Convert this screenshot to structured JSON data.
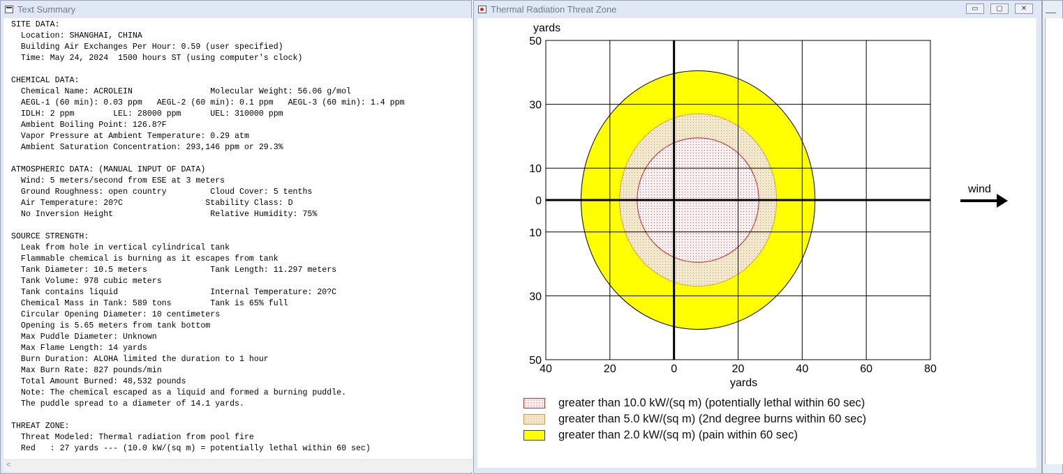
{
  "text_window": {
    "title": "Text Summary",
    "lines": [
      "SITE DATA:",
      "  Location: SHANGHAI, CHINA",
      "  Building Air Exchanges Per Hour: 0.59 (user specified)",
      "  Time: May 24, 2024  1500 hours ST (using computer's clock)",
      "",
      "CHEMICAL DATA:",
      "  Chemical Name: ACROLEIN                Molecular Weight: 56.06 g/mol",
      "  AEGL-1 (60 min): 0.03 ppm   AEGL-2 (60 min): 0.1 ppm   AEGL-3 (60 min): 1.4 ppm",
      "  IDLH: 2 ppm        LEL: 28000 ppm      UEL: 310000 ppm",
      "  Ambient Boiling Point: 126.8?F",
      "  Vapor Pressure at Ambient Temperature: 0.29 atm",
      "  Ambient Saturation Concentration: 293,146 ppm or 29.3%",
      "",
      "ATMOSPHERIC DATA: (MANUAL INPUT OF DATA)",
      "  Wind: 5 meters/second from ESE at 3 meters",
      "  Ground Roughness: open country         Cloud Cover: 5 tenths",
      "  Air Temperature: 20?C                 Stability Class: D",
      "  No Inversion Height                    Relative Humidity: 75%",
      "",
      "SOURCE STRENGTH:",
      "  Leak from hole in vertical cylindrical tank",
      "  Flammable chemical is burning as it escapes from tank",
      "  Tank Diameter: 10.5 meters             Tank Length: 11.297 meters",
      "  Tank Volume: 978 cubic meters",
      "  Tank contains liquid                   Internal Temperature: 20?C",
      "  Chemical Mass in Tank: 589 tons        Tank is 65% full",
      "  Circular Opening Diameter: 10 centimeters",
      "  Opening is 5.65 meters from tank bottom",
      "  Max Puddle Diameter: Unknown",
      "  Max Flame Length: 14 yards",
      "  Burn Duration: ALOHA limited the duration to 1 hour",
      "  Max Burn Rate: 827 pounds/min",
      "  Total Amount Burned: 48,532 pounds",
      "  Note: The chemical escaped as a liquid and formed a burning puddle.",
      "  The puddle spread to a diameter of 14.1 yards.",
      "",
      "THREAT ZONE:",
      "  Threat Modeled: Thermal radiation from pool fire",
      "  Red   : 27 yards --- (10.0 kW/(sq m) = potentially lethal within 60 sec)"
    ],
    "scroll_left_glyph": "<"
  },
  "plot_window": {
    "title": "Thermal Radiation Threat Zone",
    "buttons": {
      "minimize": "▭",
      "maximize": "▢",
      "close": "✕"
    },
    "wind_label": "wind"
  },
  "chart_data": {
    "type": "threat-zone",
    "xlabel": "yards",
    "ylabel": "yards",
    "xlim": [
      -40,
      80
    ],
    "ylim": [
      -50,
      50
    ],
    "x_ticks": [
      -40,
      -20,
      0,
      20,
      40,
      60,
      80
    ],
    "x_tick_labels": [
      "40",
      "20",
      "0",
      "20",
      "40",
      "60",
      "80"
    ],
    "y_ticks": [
      50,
      30,
      10,
      0,
      -10,
      -30,
      -50
    ],
    "y_tick_labels": [
      "50",
      "30",
      "10",
      "0",
      "10",
      "30",
      "50"
    ],
    "grid": true,
    "zones": [
      {
        "label": "greater than 2.0 kW/(sq m) (pain within 60 sec)",
        "cx": 7.5,
        "cy": 0,
        "rx": 36.5,
        "ry": 40.5,
        "fill": "#ffff00",
        "pattern": "solid",
        "stroke": "#000000"
      },
      {
        "label": "greater than 5.0 kW/(sq m) (2nd degree burns within 60 sec)",
        "cx": 7.5,
        "cy": 0,
        "rx": 24.5,
        "ry": 27,
        "fill": "#f5ecd0",
        "pattern": "dots-tan",
        "stroke": "#d4a24a"
      },
      {
        "label": "greater than 10.0 kW/(sq m) (potentially lethal within 60 sec)",
        "cx": 7.5,
        "cy": 0,
        "rx": 19,
        "ry": 19.5,
        "fill": "#fdeef0",
        "pattern": "dots-red",
        "stroke": "#c0202a"
      }
    ],
    "legend": [
      {
        "label": "greater than 10.0 kW/(sq m) (potentially lethal within 60 sec)",
        "pattern": "dots-red"
      },
      {
        "label": "greater than 5.0 kW/(sq m) (2nd degree burns within 60 sec)",
        "pattern": "dots-tan"
      },
      {
        "label": "greater than 2.0 kW/(sq m) (pain within 60 sec)",
        "pattern": "solid"
      }
    ]
  }
}
